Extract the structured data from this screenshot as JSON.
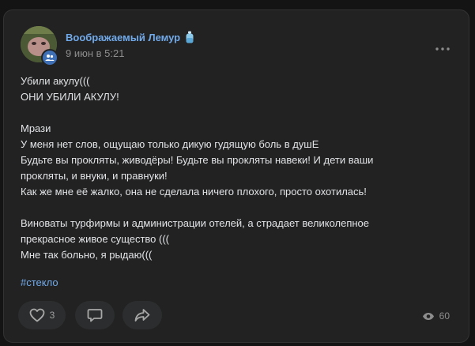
{
  "post": {
    "author": "Воображаемый Лемур",
    "date": "9 июн в 5:21",
    "lines": [
      "Убили акулу(((",
      "ОНИ УБИЛИ АКУЛУ!",
      "",
      "Мрази",
      "У меня нет слов, ощущаю только дикую гудящую боль в душЕ",
      "Будьте вы прокляты, живодёры! Будьте вы прокляты навеки! И дети ваши",
      "прокляты, и внуки, и правнуки!",
      "Как же мне её жалко, она не сделала ничего плохого, просто охотилась!",
      "",
      "Виноваты турфирмы и администрации отелей, а страдает великолепное",
      "прекрасное живое существо (((",
      "Мне так больно, я рыдаю((("
    ],
    "hashtag": "#стекло"
  },
  "actions": {
    "like_count": "3",
    "views_count": "60"
  },
  "icons": {
    "more": "more-horizontal-icon",
    "group_badge": "users-icon",
    "like": "heart-icon",
    "comment": "comment-icon",
    "share": "share-icon",
    "views": "eye-icon"
  },
  "colors": {
    "accent": "#71aaeb",
    "background": "#141414",
    "card": "#222222"
  }
}
